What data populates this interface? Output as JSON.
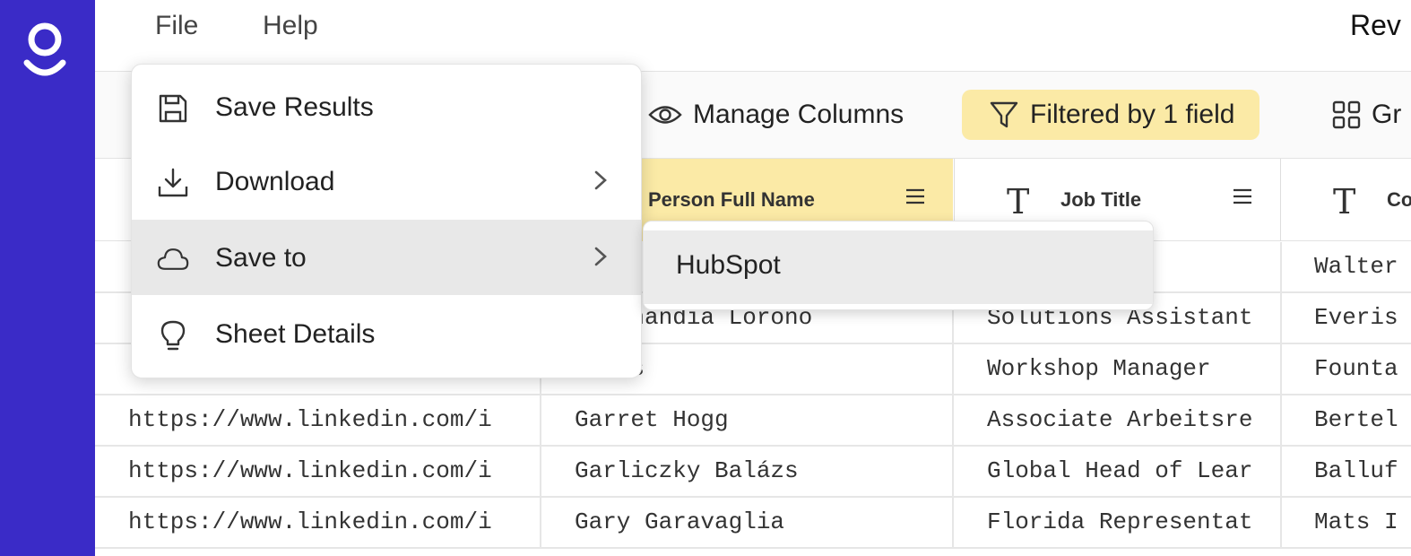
{
  "app": {
    "logo_name": "app-logo",
    "accent_color": "#3a2bc7",
    "highlight_color": "#fbeaa6"
  },
  "menubar": {
    "file_label": "File",
    "help_label": "Help",
    "title_partial": "Rev"
  },
  "toolbar": {
    "manage_columns_label": "Manage Columns",
    "filter_label": "Filtered by 1 field",
    "group_label_partial": "Gr"
  },
  "columns": {
    "name": "Person Full Name",
    "job": "Job Title",
    "company_partial": "Co"
  },
  "file_menu": {
    "items": [
      {
        "label": "Save Results",
        "icon": "save-icon"
      },
      {
        "label": "Download",
        "icon": "download-icon"
      },
      {
        "label": "Save to",
        "icon": "cloud-icon"
      },
      {
        "label": "Sheet Details",
        "icon": "lightbulb-icon"
      }
    ]
  },
  "save_to_submenu": {
    "items": [
      {
        "label": "HubSpot"
      }
    ]
  },
  "rows": [
    {
      "url": "",
      "name": "",
      "job": "",
      "company": "Walter"
    },
    {
      "url": "",
      "name": "zi Unandia Lorono",
      "job": "Solutions Assistant",
      "company": "Everis"
    },
    {
      "url": "",
      "name": "Barks",
      "job": "Workshop Manager",
      "company": "Founta"
    },
    {
      "url": "https://www.linkedin.com/i",
      "name": "Garret Hogg",
      "job": "Associate Arbeitsre",
      "company": "Bertel"
    },
    {
      "url": "https://www.linkedin.com/i",
      "name": "Garliczky Balázs",
      "job": "Global Head of Lear",
      "company": "Balluf"
    },
    {
      "url": "https://www.linkedin.com/i",
      "name": "Gary Garavaglia",
      "job": "Florida Representat",
      "company": "Mats I"
    }
  ]
}
